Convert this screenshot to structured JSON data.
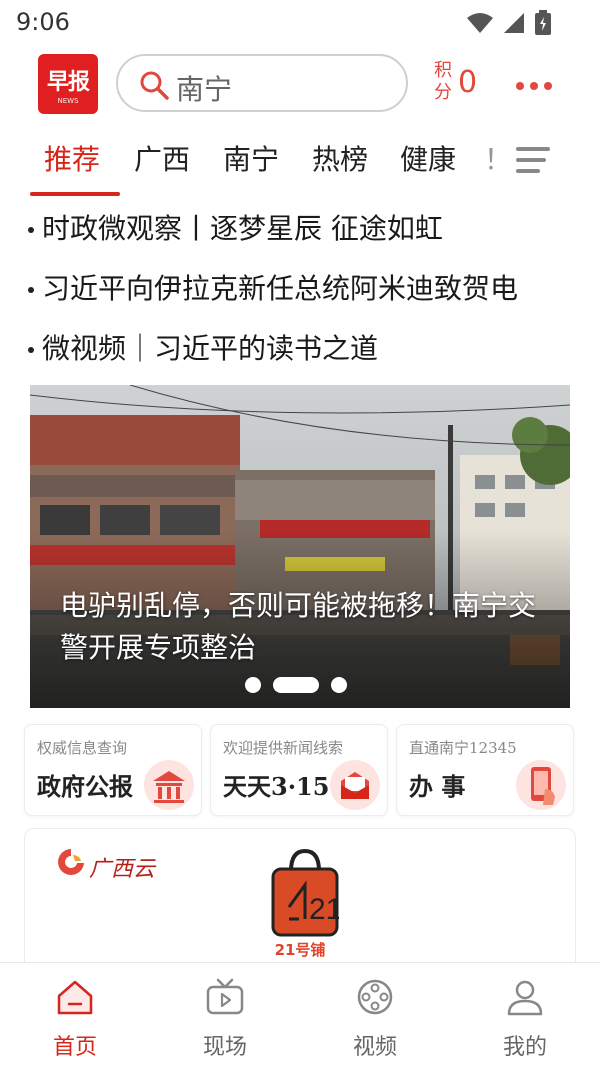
{
  "status_bar": {
    "time": "9:06"
  },
  "header": {
    "logo_text": "早报",
    "logo_sub": "NEWS",
    "search_placeholder": "南宁",
    "points_label": "积分",
    "points_value": "0"
  },
  "tabs": [
    {
      "label": "推荐",
      "active": true
    },
    {
      "label": "广西"
    },
    {
      "label": "南宁"
    },
    {
      "label": "热榜"
    },
    {
      "label": "健康"
    },
    {
      "label": "！"
    }
  ],
  "headlines": [
    "时政微观察丨逐梦星辰 征途如虹",
    "习近平向伊拉克新任总统阿米迪致贺电",
    "微视频｜习近平的读书之道"
  ],
  "banner": {
    "caption": "电驴别乱停，否则可能被拖移！南宁交警开展专项整治",
    "slide_count": 3,
    "active_slide": 2
  },
  "service_cards": [
    {
      "subtitle": "权威信息查询",
      "title": "政府公报",
      "icon": "government-building-icon"
    },
    {
      "subtitle": "欢迎提供新闻线索",
      "title": "天天3·15",
      "icon": "mail-envelope-icon"
    },
    {
      "subtitle": "直通南宁12345",
      "title": "办 事",
      "icon": "phone-hand-icon"
    }
  ],
  "partner": {
    "logo_text": "广西云",
    "shop_label": "21号铺",
    "shop_number": "21"
  },
  "bottom_nav": [
    {
      "label": "首页",
      "icon": "home-icon",
      "active": true
    },
    {
      "label": "现场",
      "icon": "tv-icon"
    },
    {
      "label": "视频",
      "icon": "film-reel-icon"
    },
    {
      "label": "我的",
      "icon": "user-icon"
    }
  ],
  "colors": {
    "brand_red": "#d6251b",
    "accent_red": "#e2483d"
  }
}
